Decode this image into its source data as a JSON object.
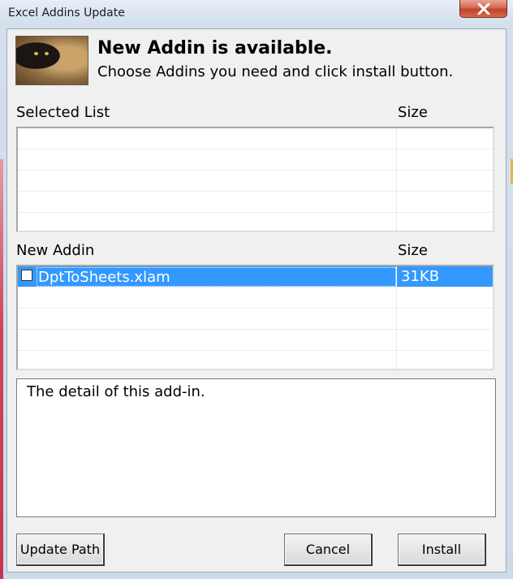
{
  "window": {
    "title": "Excel Addins Update",
    "close_glyph": "✕"
  },
  "header": {
    "title": "New Addin is available.",
    "subtitle": "Choose Addins you need and click install button."
  },
  "selected_list": {
    "label": "Selected List",
    "size_label": "Size",
    "rows": []
  },
  "new_addin": {
    "label": "New Addin",
    "size_label": "Size",
    "rows": [
      {
        "name": "DptToSheets.xlam",
        "size": "31KB",
        "checked": false,
        "selected": true
      }
    ]
  },
  "detail": {
    "text": "The detail of this add-in."
  },
  "buttons": {
    "update_path": "Update Path",
    "cancel": "Cancel",
    "install": "Install"
  },
  "colors": {
    "selection": "#3399ff",
    "close_button": "#c8452d",
    "dialog_bg": "#f0f0f0"
  },
  "icons": {
    "avatar": "black-cat-photo",
    "close": "close-icon",
    "checkbox": "checkbox-unchecked"
  }
}
